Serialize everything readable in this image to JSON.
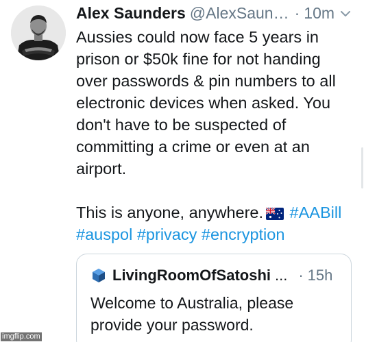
{
  "tweet": {
    "author": {
      "name": "Alex Saunders",
      "handle": "@AlexSaun…",
      "avatar_icon": "profile-photo-man"
    },
    "separator": "·",
    "timestamp": "10m",
    "menu_icon": "chevron-down-icon",
    "lines": [
      "Aussies could now face 5 years in",
      "prison or $50k fine for not handing",
      "over passwords & pin numbers to all",
      "electronic devices when asked. You",
      "don't have to be suspected of",
      "committing a crime or even at an",
      "airport."
    ],
    "closing_text": "This is anyone, anywhere.",
    "flag_icon": "australia-flag-icon",
    "hashtags": [
      "#AABill",
      "#auspol",
      "#privacy",
      "#encryption"
    ]
  },
  "quoted_tweet": {
    "avatar_icon": "blue-cube-icon",
    "name": "LivingRoomOfSatoshi",
    "ellipsis": "...",
    "separator": "·",
    "timestamp": "15h",
    "lines": [
      "Welcome to Australia, please",
      "provide your password."
    ]
  },
  "watermark": "imgflip.com",
  "colors": {
    "text": "#14171a",
    "secondary": "#657786",
    "hashtag": "#1b95e0",
    "border": "#ccd6dd"
  }
}
